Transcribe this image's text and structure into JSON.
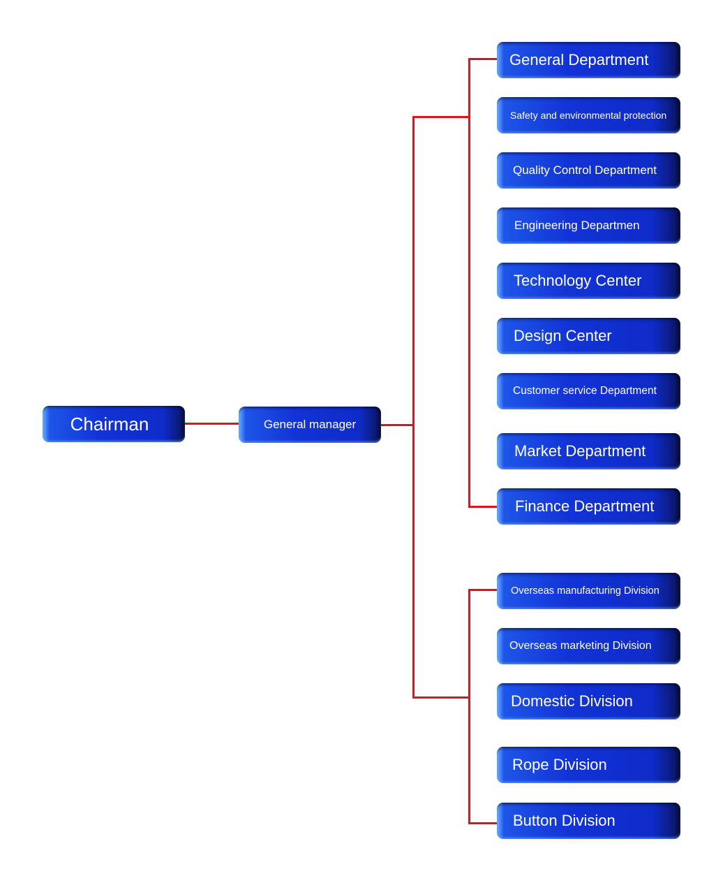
{
  "colors": {
    "box": "#1233d6",
    "connector": "#e0131c",
    "text": "#ffffff"
  },
  "chairman": {
    "label": "Chairman"
  },
  "general_manager": {
    "label": "General manager"
  },
  "departments": [
    {
      "label": "General Department"
    },
    {
      "label": "Safety and environmental protection"
    },
    {
      "label": "Quality Control Department"
    },
    {
      "label": "Engineering Departmen"
    },
    {
      "label": "Technology Center"
    },
    {
      "label": "Design Center"
    },
    {
      "label": "Customer service Department"
    },
    {
      "label": "Market Department"
    },
    {
      "label": "Finance Department"
    }
  ],
  "divisions": [
    {
      "label": "Overseas manufacturing Division"
    },
    {
      "label": "Overseas marketing Division"
    },
    {
      "label": "Domestic Division"
    },
    {
      "label": "Rope Division"
    },
    {
      "label": "Button Division"
    }
  ]
}
